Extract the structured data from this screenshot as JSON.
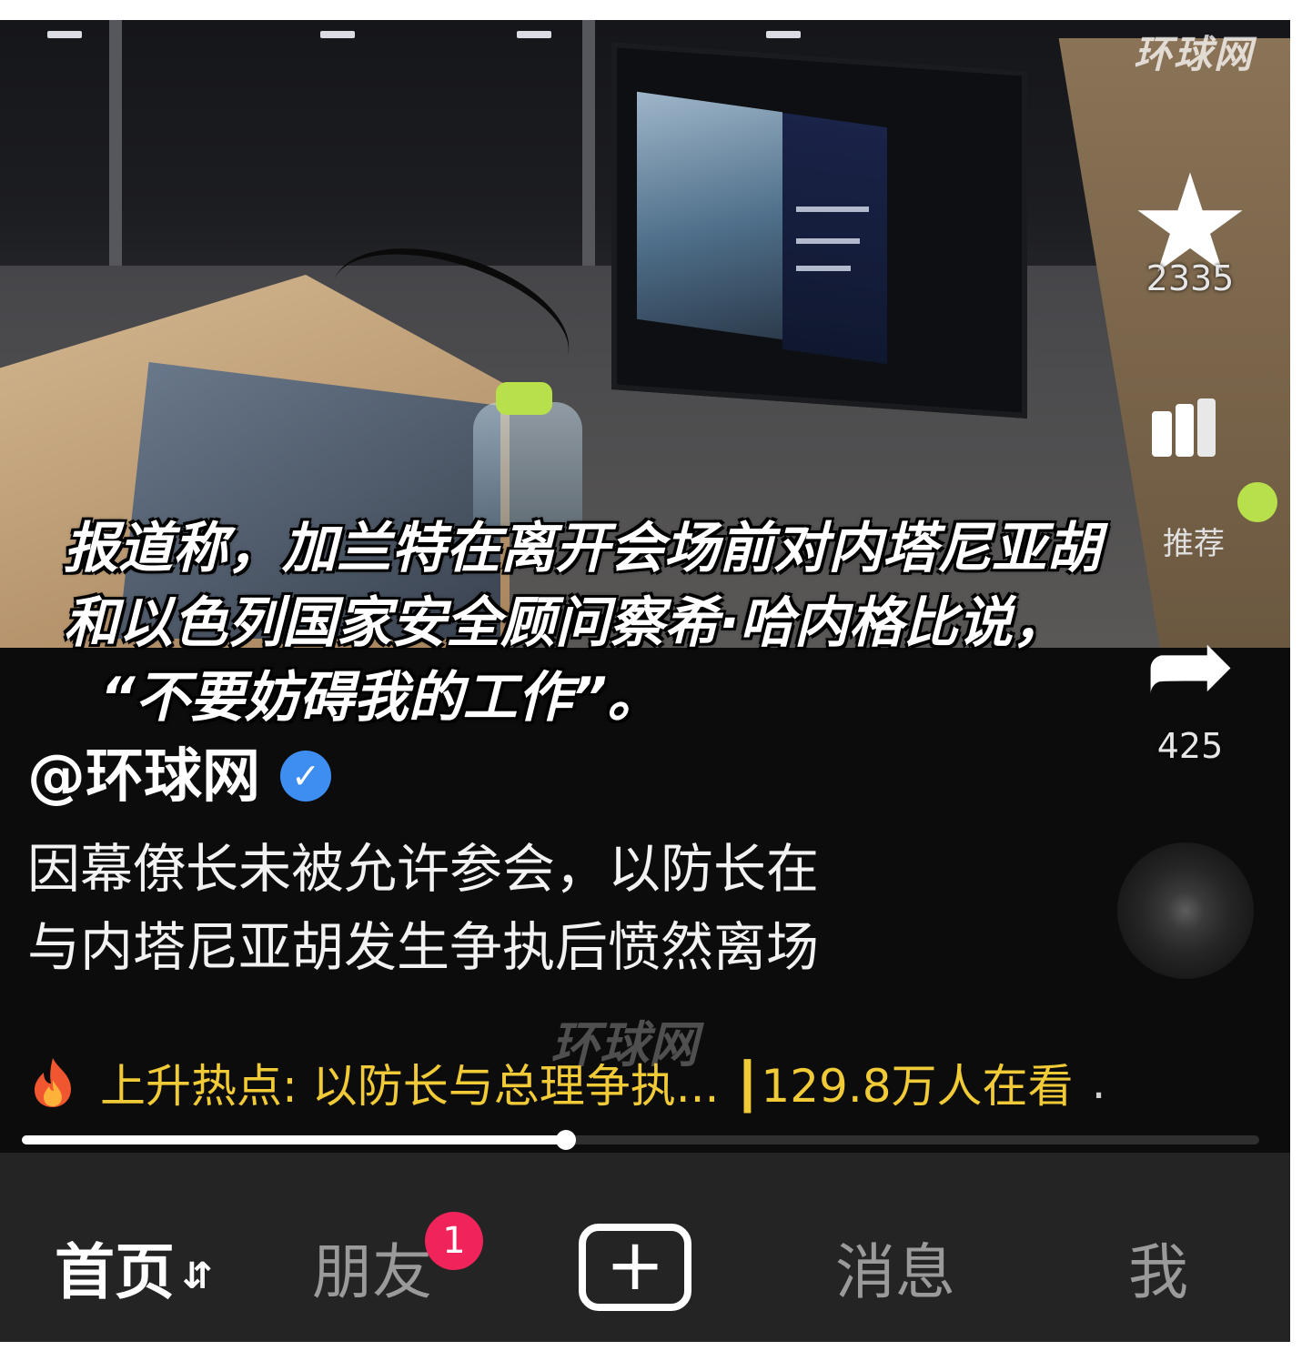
{
  "video": {
    "watermark_top": "环球网",
    "caption_lines": [
      "报道称，加兰特在离开会场前对内塔尼亚胡",
      "和以色列国家安全顾问察希·哈内格比说，",
      "“不要妨碍我的工作”。"
    ],
    "watermark_mid": "环球网"
  },
  "actions": {
    "favorite_count": "2335",
    "recommend_label": "推荐",
    "share_count": "425"
  },
  "author": {
    "name": "@环球网",
    "verified_icon": "✓"
  },
  "description": [
    "因幕僚长未被允许参会，以防长在",
    "与内塔尼亚胡发生争执后愤然离场"
  ],
  "hot_topic": {
    "text": "上升热点: 以防长与总理争执... ┃129.8万人在看",
    "suffix": "."
  },
  "progress": {
    "fraction": 0.44
  },
  "tabbar": {
    "home": "首页",
    "home_arrows": "⇵",
    "friends": "朋友",
    "friends_badge": "1",
    "create": "+",
    "messages": "消息",
    "me": "我"
  },
  "colors": {
    "hot_text": "#f1cb37",
    "badge": "#f0245a",
    "verified": "#3d8ef0"
  }
}
